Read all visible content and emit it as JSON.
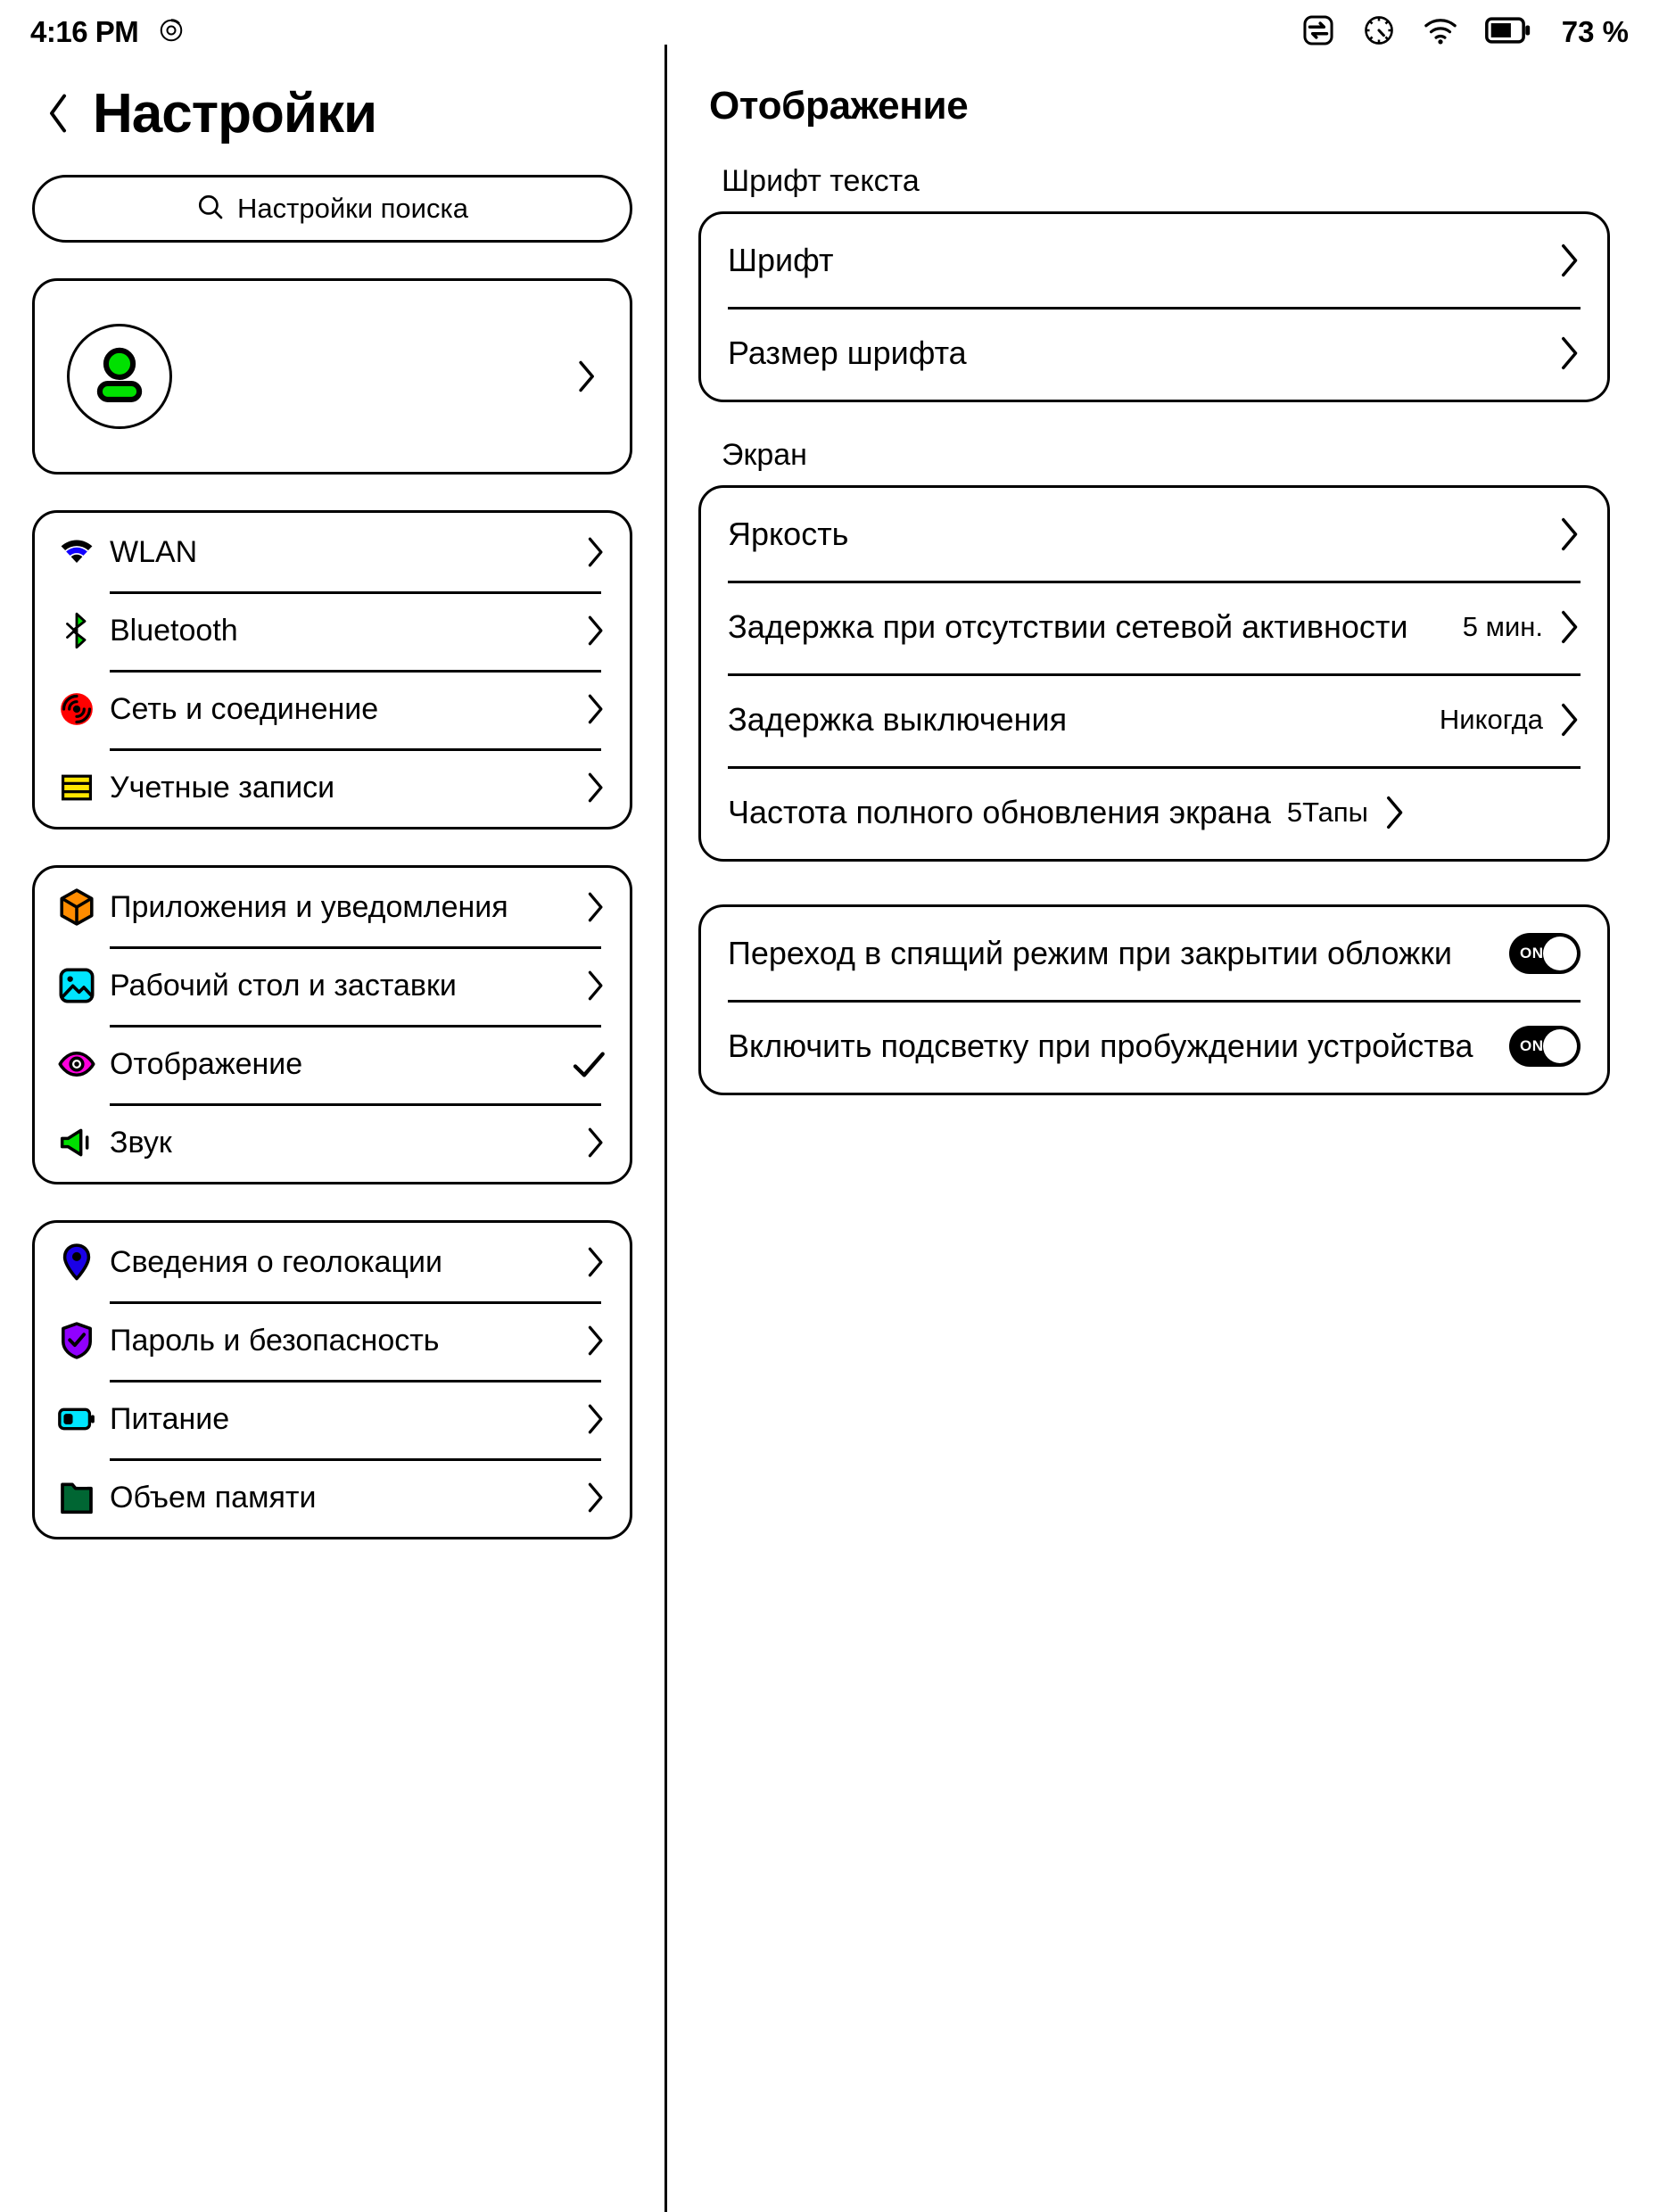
{
  "statusbar": {
    "time": "4:16 PM",
    "left_icons": [
      "refresh-circle-icon"
    ],
    "right_icons": [
      "data-transfer-icon",
      "speedometer-icon",
      "wifi-icon",
      "battery-icon"
    ],
    "battery_percent": "73 %"
  },
  "sidebar": {
    "back_label": "back-chevron",
    "title": "Настройки",
    "search": {
      "placeholder": "Настройки поиска",
      "value": ""
    },
    "profile": {
      "name": "",
      "icon": "user-avatar-icon"
    },
    "groups": [
      {
        "items": [
          {
            "label": "WLAN",
            "icon": "wifi-icon",
            "color": "#1200ff",
            "accessory": "chevron"
          },
          {
            "label": "Bluetooth",
            "icon": "bluetooth-icon",
            "color": "#00e000",
            "accessory": "chevron"
          },
          {
            "label": "Сеть и соединение",
            "icon": "network-icon",
            "color": "#ff0000",
            "accessory": "chevron"
          },
          {
            "label": "Учетные записи",
            "icon": "accounts-icon",
            "color": "#ffe600",
            "accessory": "chevron"
          }
        ]
      },
      {
        "items": [
          {
            "label": "Приложения и уведомления",
            "icon": "apps-cube-icon",
            "color": "#ff8c00",
            "accessory": "chevron"
          },
          {
            "label": "Рабочий стол и заставки",
            "icon": "wallpaper-icon",
            "color": "#00e5ff",
            "accessory": "chevron"
          },
          {
            "label": "Отображение",
            "icon": "display-eye-icon",
            "color": "#ff00dd",
            "accessory": "check"
          },
          {
            "label": "Звук",
            "icon": "sound-icon",
            "color": "#00e000",
            "accessory": "chevron"
          }
        ]
      },
      {
        "items": [
          {
            "label": "Сведения о геолокации",
            "icon": "location-pin-icon",
            "color": "#1a00e6",
            "accessory": "chevron"
          },
          {
            "label": "Пароль и безопасность",
            "icon": "shield-check-icon",
            "color": "#9100ff",
            "accessory": "chevron"
          },
          {
            "label": "Питание",
            "icon": "power-battery-icon",
            "color": "#00e5ff",
            "accessory": "chevron"
          },
          {
            "label": "Объем памяти",
            "icon": "storage-folder-icon",
            "color": "#006633",
            "accessory": "chevron"
          }
        ]
      }
    ]
  },
  "main": {
    "title": "Отображение",
    "sections": [
      {
        "label": "Шрифт текста",
        "rows": [
          {
            "label": "Шрифт",
            "value": "",
            "accessory": "chevron"
          },
          {
            "label": "Размер шрифта",
            "value": "",
            "accessory": "chevron"
          }
        ]
      },
      {
        "label": "Экран",
        "rows": [
          {
            "label": "Яркость",
            "value": "",
            "accessory": "chevron"
          },
          {
            "label": "Задержка при отсутствии сетевой активности",
            "value": "5 мин.",
            "accessory": "chevron"
          },
          {
            "label": "Задержка выключения",
            "value": "Никогда",
            "accessory": "chevron"
          },
          {
            "label": "Частота полного обновления экрана",
            "value": "5Тапы",
            "accessory": "chevron"
          }
        ]
      }
    ],
    "toggles": [
      {
        "label": "Переход в спящий режим при закрытии обложки",
        "state": "ON"
      },
      {
        "label": "Включить подсветку при пробуждении устройства",
        "state": "ON"
      }
    ]
  }
}
